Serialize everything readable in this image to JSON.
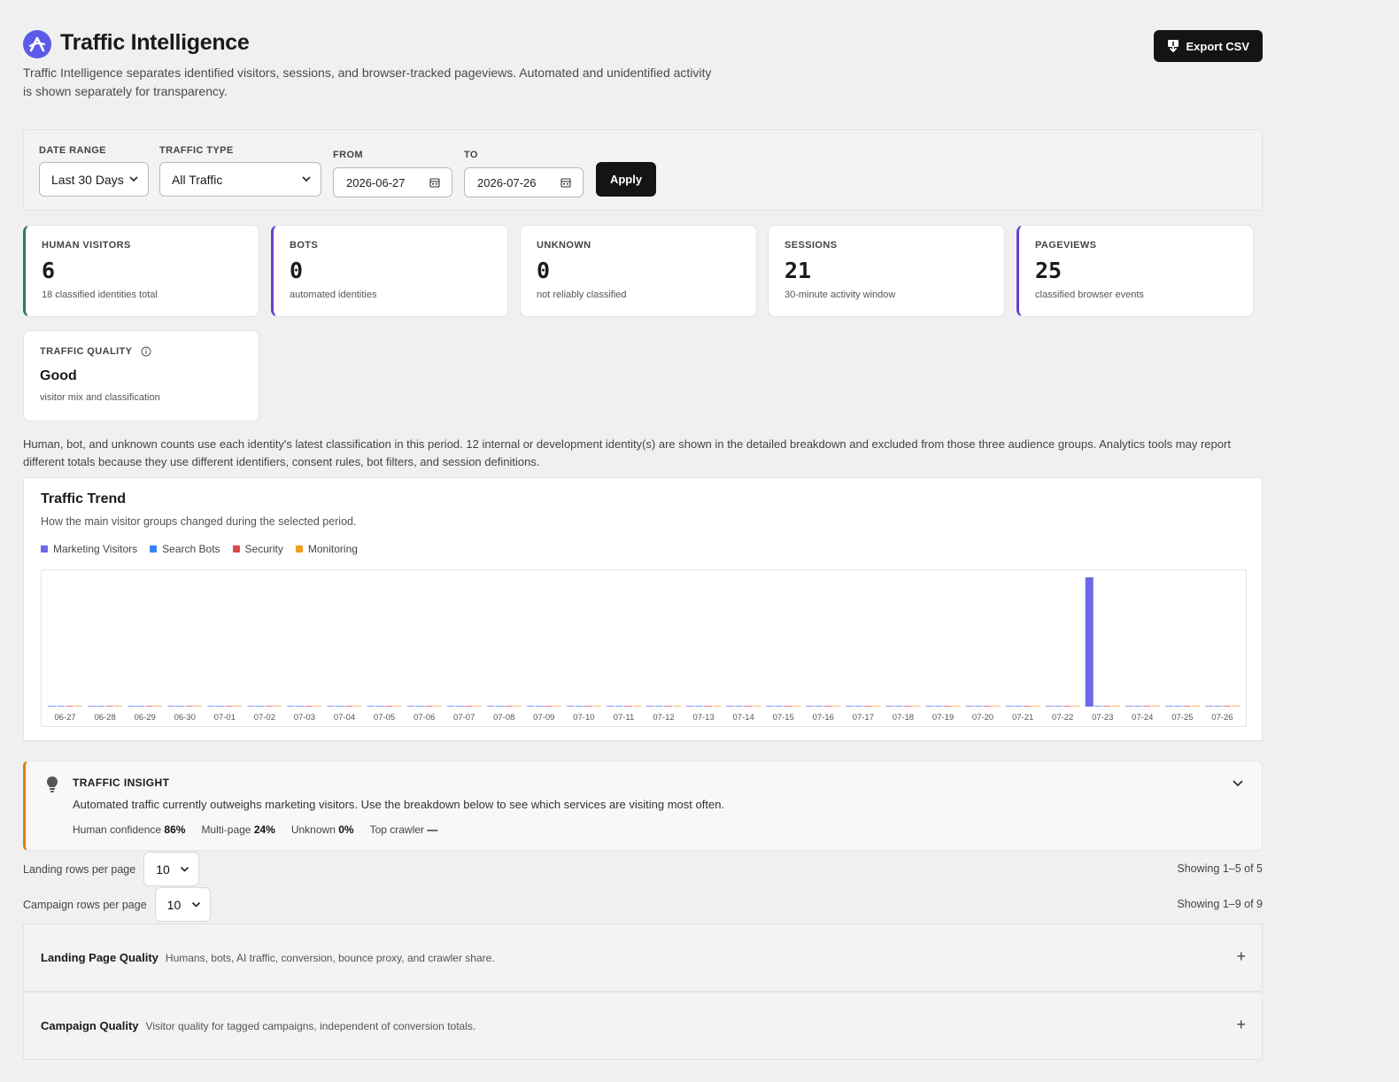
{
  "header": {
    "title": "Traffic Intelligence",
    "subtitle": "Traffic Intelligence separates identified visitors, sessions, and browser-tracked pageviews. Automated and unidentified activity is shown separately for transparency.",
    "export_label": "Export CSV"
  },
  "filters": {
    "date_range_label": "DATE RANGE",
    "date_range_value": "Last 30 Days",
    "traffic_type_label": "TRAFFIC TYPE",
    "traffic_type_value": "All Traffic",
    "from_label": "FROM",
    "from_value": "2026-06-27",
    "to_label": "TO",
    "to_value": "2026-07-26",
    "apply_label": "Apply"
  },
  "stats": [
    {
      "label": "HUMAN VISITORS",
      "value": "6",
      "desc": "18 classified identities total"
    },
    {
      "label": "BOTS",
      "value": "0",
      "desc": "automated identities"
    },
    {
      "label": "UNKNOWN",
      "value": "0",
      "desc": "not reliably classified"
    },
    {
      "label": "SESSIONS",
      "value": "21",
      "desc": "30-minute activity window"
    },
    {
      "label": "PAGEVIEWS",
      "value": "25",
      "desc": "classified browser events"
    }
  ],
  "quality": {
    "label": "TRAFFIC QUALITY",
    "value": "Good",
    "desc": "visitor mix and classification"
  },
  "note": "Human, bot, and unknown counts use each identity's latest classification in this period. 12 internal or development identity(s) are shown in the detailed breakdown and excluded from those three audience groups. Analytics tools may report different totals because they use different identifiers, consent rules, bot filters, and session definitions.",
  "trend": {
    "title": "Traffic Trend",
    "subtitle": "How the main visitor groups changed during the selected period."
  },
  "colors": {
    "marketing": "#6b6be8",
    "search_bots": "#3b82f6",
    "security": "#e0474c",
    "monitoring": "#f0a020",
    "accent": "#141414"
  },
  "chart_data": {
    "type": "bar",
    "title": "",
    "xlabel": "",
    "ylabel": "",
    "legend": "top-left",
    "grid": false,
    "categories": [
      "06-27",
      "06-28",
      "06-29",
      "06-30",
      "07-01",
      "07-02",
      "07-03",
      "07-04",
      "07-05",
      "07-06",
      "07-07",
      "07-08",
      "07-09",
      "07-10",
      "07-11",
      "07-12",
      "07-13",
      "07-14",
      "07-15",
      "07-16",
      "07-17",
      "07-18",
      "07-19",
      "07-20",
      "07-21",
      "07-22",
      "07-23",
      "07-24",
      "07-25",
      "07-26"
    ],
    "ylim": [
      0,
      6
    ],
    "series": [
      {
        "name": "Marketing Visitors",
        "values": [
          0,
          0,
          0,
          0,
          0,
          0,
          0,
          0,
          0,
          0,
          0,
          0,
          0,
          0,
          0,
          0,
          0,
          0,
          0,
          0,
          0,
          0,
          0,
          0,
          0,
          0,
          6,
          0,
          0,
          0
        ]
      },
      {
        "name": "Search Bots",
        "values": [
          0,
          0,
          0,
          0,
          0,
          0,
          0,
          0,
          0,
          0,
          0,
          0,
          0,
          0,
          0,
          0,
          0,
          0,
          0,
          0,
          0,
          0,
          0,
          0,
          0,
          0,
          0,
          0,
          0,
          0
        ]
      },
      {
        "name": "Security",
        "values": [
          0,
          0,
          0,
          0,
          0,
          0,
          0,
          0,
          0,
          0,
          0,
          0,
          0,
          0,
          0,
          0,
          0,
          0,
          0,
          0,
          0,
          0,
          0,
          0,
          0,
          0,
          0,
          0,
          0,
          0
        ]
      },
      {
        "name": "Monitoring",
        "values": [
          0,
          0,
          0,
          0,
          0,
          0,
          0,
          0,
          0,
          0,
          0,
          0,
          0,
          0,
          0,
          0,
          0,
          0,
          0,
          0,
          0,
          0,
          0,
          0,
          0,
          0,
          0,
          0,
          0,
          0
        ]
      }
    ]
  },
  "insight": {
    "title": "TRAFFIC INSIGHT",
    "text": "Automated traffic currently outweighs marketing visitors. Use the breakdown below to see which services are visiting most often.",
    "human_confidence_label": "Human confidence",
    "human_confidence_value": "86%",
    "multi_page_label": "Multi-page",
    "multi_page_value": "24%",
    "unknown_label": "Unknown",
    "unknown_value": "0%",
    "top_crawler_label": "Top crawler",
    "top_crawler_value": "—"
  },
  "landing_rows": {
    "label": "Landing rows per page",
    "value": "10",
    "showing": "Showing 1–5 of 5"
  },
  "campaign_rows": {
    "label": "Campaign rows per page",
    "value": "10",
    "showing": "Showing 1–9 of 9"
  },
  "sections": [
    {
      "title": "Landing Page Quality",
      "desc": "Humans, bots, AI traffic, conversion, bounce proxy, and crawler share."
    },
    {
      "title": "Campaign Quality",
      "desc": "Visitor quality for tagged campaigns, independent of conversion totals."
    }
  ]
}
